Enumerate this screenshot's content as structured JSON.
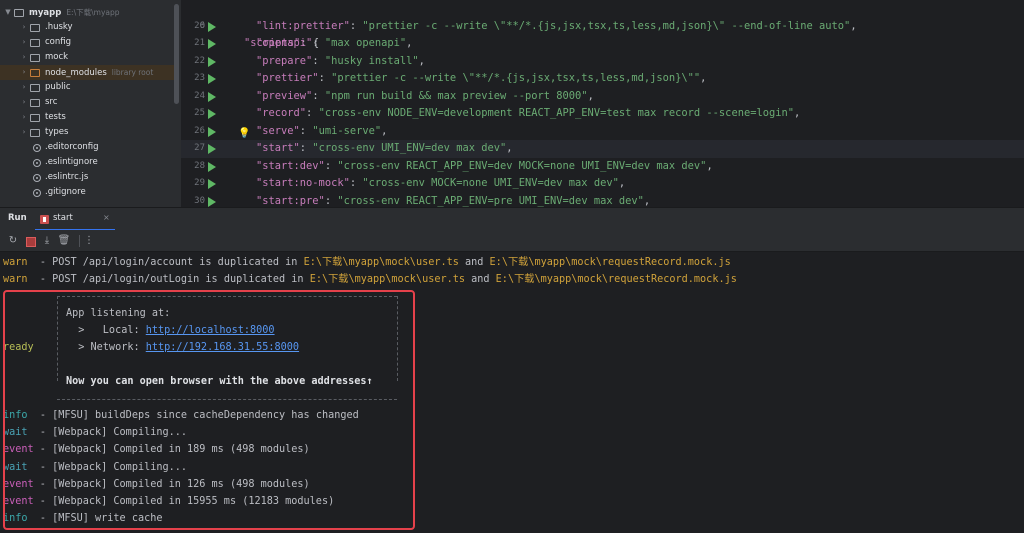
{
  "project": {
    "root": {
      "name": "myapp",
      "path": "E:\\下载\\myapp"
    },
    "items": [
      {
        "label": ".husky",
        "type": "folder"
      },
      {
        "label": "config",
        "type": "folder"
      },
      {
        "label": "mock",
        "type": "folder"
      },
      {
        "label": "node_modules",
        "type": "folder",
        "hint": "library root"
      },
      {
        "label": "public",
        "type": "folder"
      },
      {
        "label": "src",
        "type": "folder"
      },
      {
        "label": "tests",
        "type": "folder"
      },
      {
        "label": "types",
        "type": "folder"
      },
      {
        "label": ".editorconfig",
        "type": "file"
      },
      {
        "label": ".eslintignore",
        "type": "file"
      },
      {
        "label": ".eslintrc.js",
        "type": "file"
      },
      {
        "label": ".gitignore",
        "type": "file"
      }
    ]
  },
  "editor": {
    "header": {
      "number": "6",
      "key": "\"scripts\"",
      "rest": ": {"
    },
    "lines": [
      {
        "number": "20",
        "key": "\"lint:prettier\"",
        "value": "\"prettier -c --write \\\"**/*.{js,jsx,tsx,ts,less,md,json}\\\" --end-of-line auto\""
      },
      {
        "number": "21",
        "key": "\"openapi\"",
        "value": "\"max openapi\""
      },
      {
        "number": "22",
        "key": "\"prepare\"",
        "value": "\"husky install\""
      },
      {
        "number": "23",
        "key": "\"prettier\"",
        "value": "\"prettier -c --write \\\"**/*.{js,jsx,tsx,ts,less,md,json}\\\"\""
      },
      {
        "number": "24",
        "key": "\"preview\"",
        "value": "\"npm run build && max preview --port 8000\""
      },
      {
        "number": "25",
        "key": "\"record\"",
        "value": "\"cross-env NODE_ENV=development REACT_APP_ENV=test max record --scene=login\""
      },
      {
        "number": "26",
        "key": "\"serve\"",
        "value": "\"umi-serve\""
      },
      {
        "number": "27",
        "key": "\"start\"",
        "value": "\"cross-env UMI_ENV=dev max dev\""
      },
      {
        "number": "28",
        "key": "\"start:dev\"",
        "value": "\"cross-env REACT_APP_ENV=dev MOCK=none UMI_ENV=dev max dev\""
      },
      {
        "number": "29",
        "key": "\"start:no-mock\"",
        "value": "\"cross-env MOCK=none UMI_ENV=dev max dev\""
      },
      {
        "number": "30",
        "key": "\"start:pre\"",
        "value": "\"cross-env REACT_APP_ENV=pre UMI_ENV=dev max dev\""
      }
    ]
  },
  "run": {
    "title": "Run",
    "tab_label": "start",
    "tab_close": "×"
  },
  "console": {
    "warn1": {
      "tag": "warn",
      "text": "  - POST /api/login/account is duplicated in ",
      "path1": "E:\\下载\\myapp\\mock\\user.ts",
      "and": " and ",
      "path2": "E:\\下载\\myapp\\mock\\requestRecord.mock.js"
    },
    "warn2": {
      "tag": "warn",
      "text": "  - POST /api/login/outLogin is duplicated in ",
      "path1": "E:\\下载\\myapp\\mock\\user.ts",
      "and": " and ",
      "path2": "E:\\下载\\myapp\\mock\\requestRecord.mock.js"
    },
    "box": {
      "listening": "App listening at:",
      "local_label": "  >   Local: ",
      "local_url": "http://localhost:8000",
      "network_label": "  > Network: ",
      "network_url": "http://192.168.31.55:8000",
      "ready_tag": "ready",
      "open_msg": "Now you can open browser with the above addresses↑"
    },
    "logs": [
      {
        "tag": "info",
        "cls": "info",
        "text": "  - [MFSU] buildDeps since cacheDependency has changed"
      },
      {
        "tag": "wait",
        "cls": "wait",
        "text": "  - [Webpack] Compiling..."
      },
      {
        "tag": "event",
        "cls": "event",
        "text": " - [Webpack] Compiled in 189 ms (498 modules)"
      },
      {
        "tag": "wait",
        "cls": "wait",
        "text": "  - [Webpack] Compiling..."
      },
      {
        "tag": "event",
        "cls": "event",
        "text": " - [Webpack] Compiled in 126 ms (498 modules)"
      },
      {
        "tag": "event",
        "cls": "event",
        "text": " - [Webpack] Compiled in 15955 ms (12183 modules)"
      },
      {
        "tag": "info",
        "cls": "info",
        "text": "  - [MFSU] write cache"
      }
    ]
  },
  "colors": {
    "highlight": "#e5414b",
    "accent": "#3574f0",
    "run": "#5fb865"
  }
}
